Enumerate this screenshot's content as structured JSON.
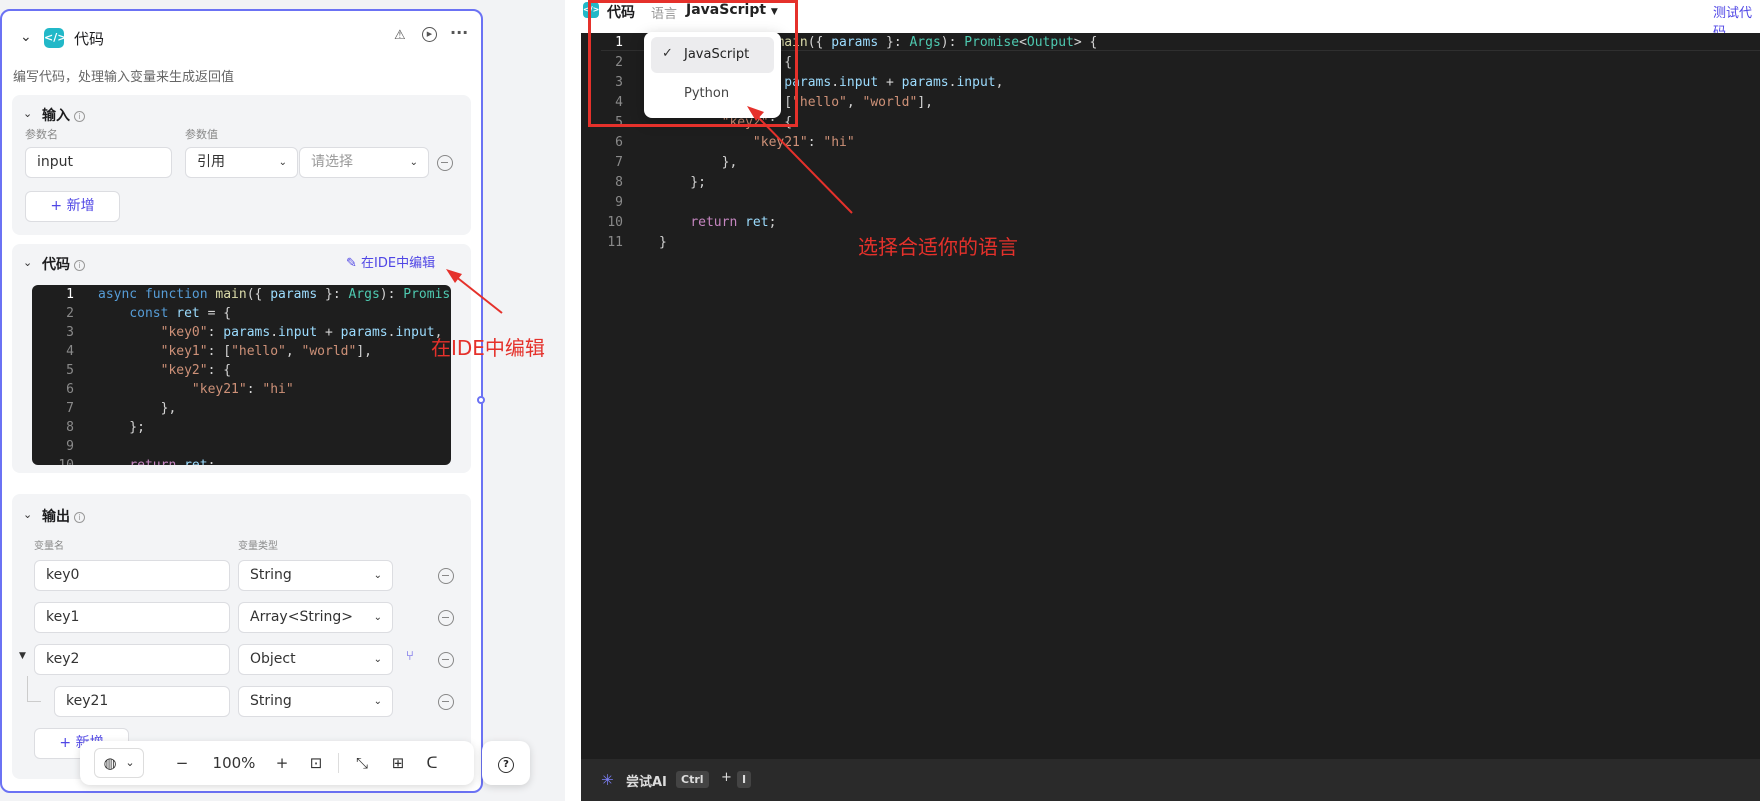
{
  "node": {
    "title": "代码",
    "description": "编写代码，处理输入变量来生成返回值",
    "input_section": {
      "title": "输入",
      "col_name": "参数名",
      "col_value": "参数值",
      "param_name": "input",
      "ref_mode": "引用",
      "value_placeholder": "请选择",
      "add_label": "+ 新增"
    },
    "code_section": {
      "title": "代码",
      "ide_label": "在IDE中编辑",
      "lines": [
        {
          "n": "1",
          "text": "async function main({ params }: Args): Promise<Output> {"
        },
        {
          "n": "2",
          "text": "    const ret = {"
        },
        {
          "n": "3",
          "text": "        \"key0\": params.input + params.input,"
        },
        {
          "n": "4",
          "text": "        \"key1\": [\"hello\", \"world\"],"
        },
        {
          "n": "5",
          "text": "        \"key2\": {"
        },
        {
          "n": "6",
          "text": "            \"key21\": \"hi\""
        },
        {
          "n": "7",
          "text": "        },"
        },
        {
          "n": "8",
          "text": "    };"
        },
        {
          "n": "9",
          "text": ""
        },
        {
          "n": "10",
          "text": "    return ret;"
        }
      ]
    },
    "output_section": {
      "title": "输出",
      "col_name": "变量名",
      "col_type": "变量类型",
      "rows": [
        {
          "name": "key0",
          "type": "String"
        },
        {
          "name": "key1",
          "type": "Array<String>"
        },
        {
          "name": "key2",
          "type": "Object"
        },
        {
          "name": "key21",
          "type": "String"
        }
      ],
      "add_label": "+ 新增"
    }
  },
  "toolbar": {
    "zoom": "100%"
  },
  "editor": {
    "title": "代码",
    "lang_label": "语言",
    "lang_value": "JavaScript",
    "test_label": "测试代码",
    "menu_options": [
      "JavaScript",
      "Python"
    ],
    "lines": [
      "1",
      "2",
      "3",
      "4",
      "5",
      "6",
      "7",
      "8",
      "9",
      "10",
      "11"
    ],
    "ai_label": "尝试AI",
    "shortcut_ctrl": "Ctrl",
    "shortcut_plus": "+",
    "shortcut_key": "I"
  },
  "annotations": {
    "ide": "在IDE中编辑",
    "lang": "选择合适你的语言"
  },
  "colors": {
    "accent": "#4f46e5",
    "annotation": "#e5312b",
    "node_border": "#6b72f4"
  }
}
